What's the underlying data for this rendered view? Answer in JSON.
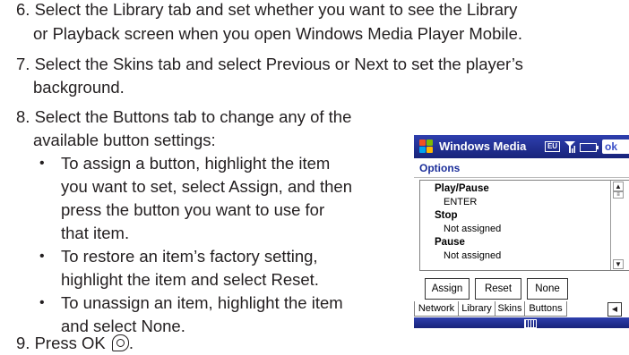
{
  "steps": {
    "s6_l1": "6. Select the Library tab and set whether you want to see the Library",
    "s6_l2": "or Playback screen when you open Windows Media Player Mobile.",
    "s7_l1": "7. Select the Skins tab and select Previous or Next to set the player’s",
    "s7_l2": "background.",
    "s8_l1": "8. Select the Buttons tab to change any of the",
    "s8_l2": "available button settings:",
    "b1_l1": "To assign a button, highlight the item",
    "b1_l2": "you want to set, select Assign, and then",
    "b1_l3": "press the button you want to use for",
    "b1_l4": "that item.",
    "b2_l1": "To restore an item’s factory setting,",
    "b2_l2": "highlight the item and select Reset.",
    "b3_l1": "To unassign an item, highlight the item",
    "b3_l2": "and select None.",
    "s9": "9. Press OK",
    "s9_end": "."
  },
  "bullet_char": "•",
  "device": {
    "title": "Windows Media",
    "keyboard_indicator": "EU",
    "ok_label": "ok",
    "options_header": "Options",
    "items": [
      {
        "title": "Play/Pause",
        "value": "ENTER"
      },
      {
        "title": "Stop",
        "value": "Not assigned"
      },
      {
        "title": "Pause",
        "value": "Not assigned"
      }
    ],
    "buttons": {
      "assign": "Assign",
      "reset": "Reset",
      "none": "None"
    },
    "tabs": [
      "Network",
      "Library",
      "Skins",
      "Buttons"
    ],
    "colors": {
      "titlebar": "#22309a",
      "options": "#1c2f9a"
    }
  }
}
